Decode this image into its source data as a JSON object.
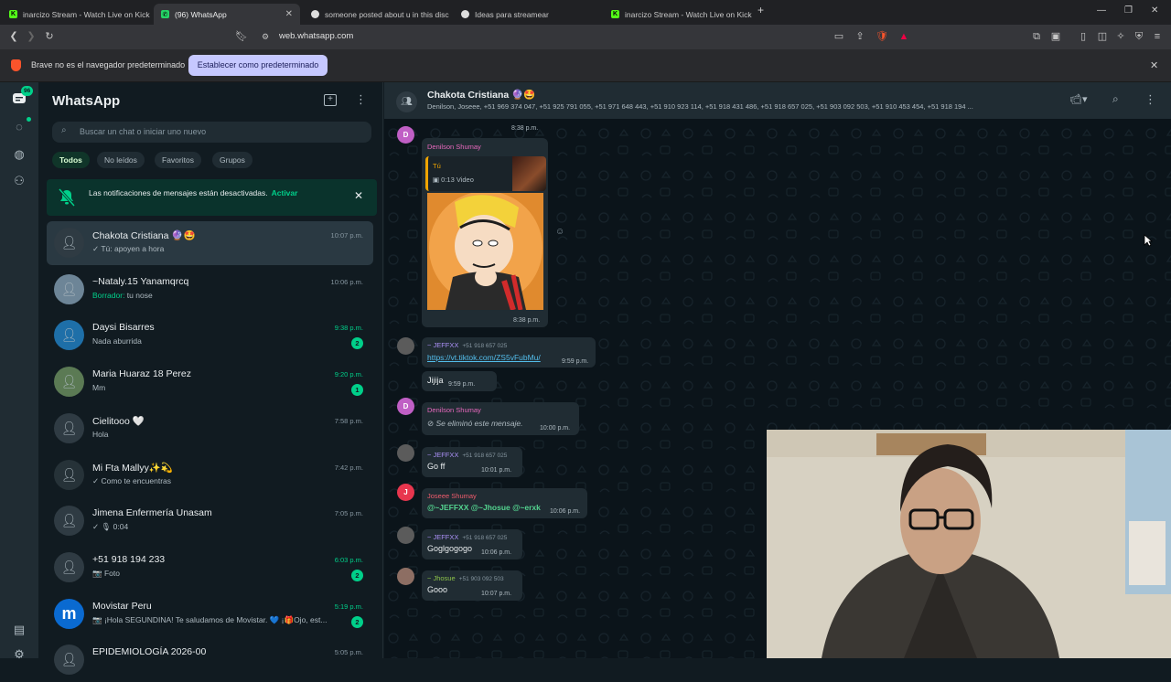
{
  "browser": {
    "tabs": [
      {
        "label": "inarcizo Stream - Watch Live on Kick",
        "active": false
      },
      {
        "label": "(96) WhatsApp",
        "active": true
      },
      {
        "label": "someone posted about u in this disc",
        "active": false
      },
      {
        "label": "Ideas para streamear",
        "active": false
      },
      {
        "label": "inarcizo Stream - Watch Live on Kick",
        "active": false
      }
    ],
    "url": "web.whatsapp.com",
    "infobar_message": "Brave no es el navegador predeterminado",
    "infobar_button": "Establecer como predeterminado",
    "rail_badge": "96"
  },
  "sidebar": {
    "title": "WhatsApp",
    "search_placeholder": "Buscar un chat o iniciar uno nuevo",
    "filters": [
      "Todos",
      "No leídos",
      "Favoritos",
      "Grupos"
    ],
    "notification": {
      "text": "Las notificaciones de mensajes están desactivadas.",
      "action": "Activar"
    },
    "chats": [
      {
        "name": "Chakota Cristiana 🔮🤩",
        "preview": "✓ Tú: apoyen a hora",
        "time": "10:07 p.m.",
        "unread": "",
        "selected": true
      },
      {
        "name": "~Nataly.15 Yanamqrcq",
        "preview_draft": "Borrador:",
        "preview": " tu nose",
        "time": "10:06 p.m.",
        "unread": "",
        "selected": false
      },
      {
        "name": "Daysi Bisarres",
        "preview": "Nada aburrida",
        "time": "9:38 p.m.",
        "unread": "2",
        "selected": false
      },
      {
        "name": "Maria Huaraz 18 Perez",
        "preview": "Mm",
        "time": "9:20 p.m.",
        "unread": "1",
        "selected": false
      },
      {
        "name": "Cielitooo 🤍",
        "preview": "Hola",
        "time": "7:58 p.m.",
        "unread": "",
        "selected": false
      },
      {
        "name": "Mi Fta Mallyy✨💫",
        "preview": "✓ Como te encuentras",
        "time": "7:42 p.m.",
        "unread": "",
        "selected": false
      },
      {
        "name": "Jimena Enfermería Unasam",
        "preview": "✓ 🎙 0:04",
        "time": "7:05 p.m.",
        "unread": "",
        "selected": false
      },
      {
        "name": "+51 918 194 233",
        "preview": "📷 Foto",
        "time": "6:03 p.m.",
        "unread": "2",
        "selected": false
      },
      {
        "name": "Movistar Peru",
        "preview": "📷 ¡Hola SEGUNDINA! Te saludamos de Movistar. 💙 ¡🎁Ojo, est...",
        "time": "5:19 p.m.",
        "unread": "2",
        "selected": false
      },
      {
        "name": "EPIDEMIOLOGÍA 2026-00",
        "preview": "",
        "time": "5:05 p.m.",
        "unread": "",
        "selected": false
      }
    ]
  },
  "conversation": {
    "title": "Chakota Cristiana 🔮🤩",
    "members": "Denilson, Joseee, +51 969 374 047, +51 925 791 055, +51 971 648 443, +51 910 923 114, +51 918 431 486, +51 918 657 025, +51 903 092 503, +51 910 453 454, +51 918 194 ...",
    "messages": [
      {
        "time": "8:38 p.m."
      },
      {
        "sender": "Denilson Shumay",
        "avatar": "D",
        "reply_to": "Tú",
        "reply_text": "0:13 Video",
        "time": "8:38 p.m."
      },
      {
        "sender": "~ JEFFXX",
        "number": "+51 918 657 025",
        "link": "https://vt.tiktok.com/ZS5vFubMu/",
        "time": "9:59 p.m."
      },
      {
        "text": "Jijija",
        "time": "9:59 p.m."
      },
      {
        "sender": "Denilson Shumay",
        "avatar": "D",
        "deleted": "Se eliminó este mensaje.",
        "time": "10:00 p.m."
      },
      {
        "sender": "~ JEFFXX",
        "number": "+51 918 657 025",
        "text": "Go ff",
        "time": "10:01 p.m."
      },
      {
        "sender": "Joseee Shumay",
        "avatar": "J",
        "mentions": "@~JEFFXX @~Jhosue @~erxk",
        "time": "10:06 p.m."
      },
      {
        "sender": "~ JEFFXX",
        "number": "+51 918 657 025",
        "text": "Goglgogogo",
        "time": "10:06 p.m."
      },
      {
        "sender": "~ Jhosue",
        "number": "+51 903 092 503",
        "text": "Gooo",
        "time": "10:07 p.m."
      }
    ]
  },
  "colors": {
    "accent": "#00d08a",
    "panel": "#111b21",
    "header": "#202c33",
    "bubble": "#202c33",
    "infobar_button": "#c6c8ff"
  }
}
